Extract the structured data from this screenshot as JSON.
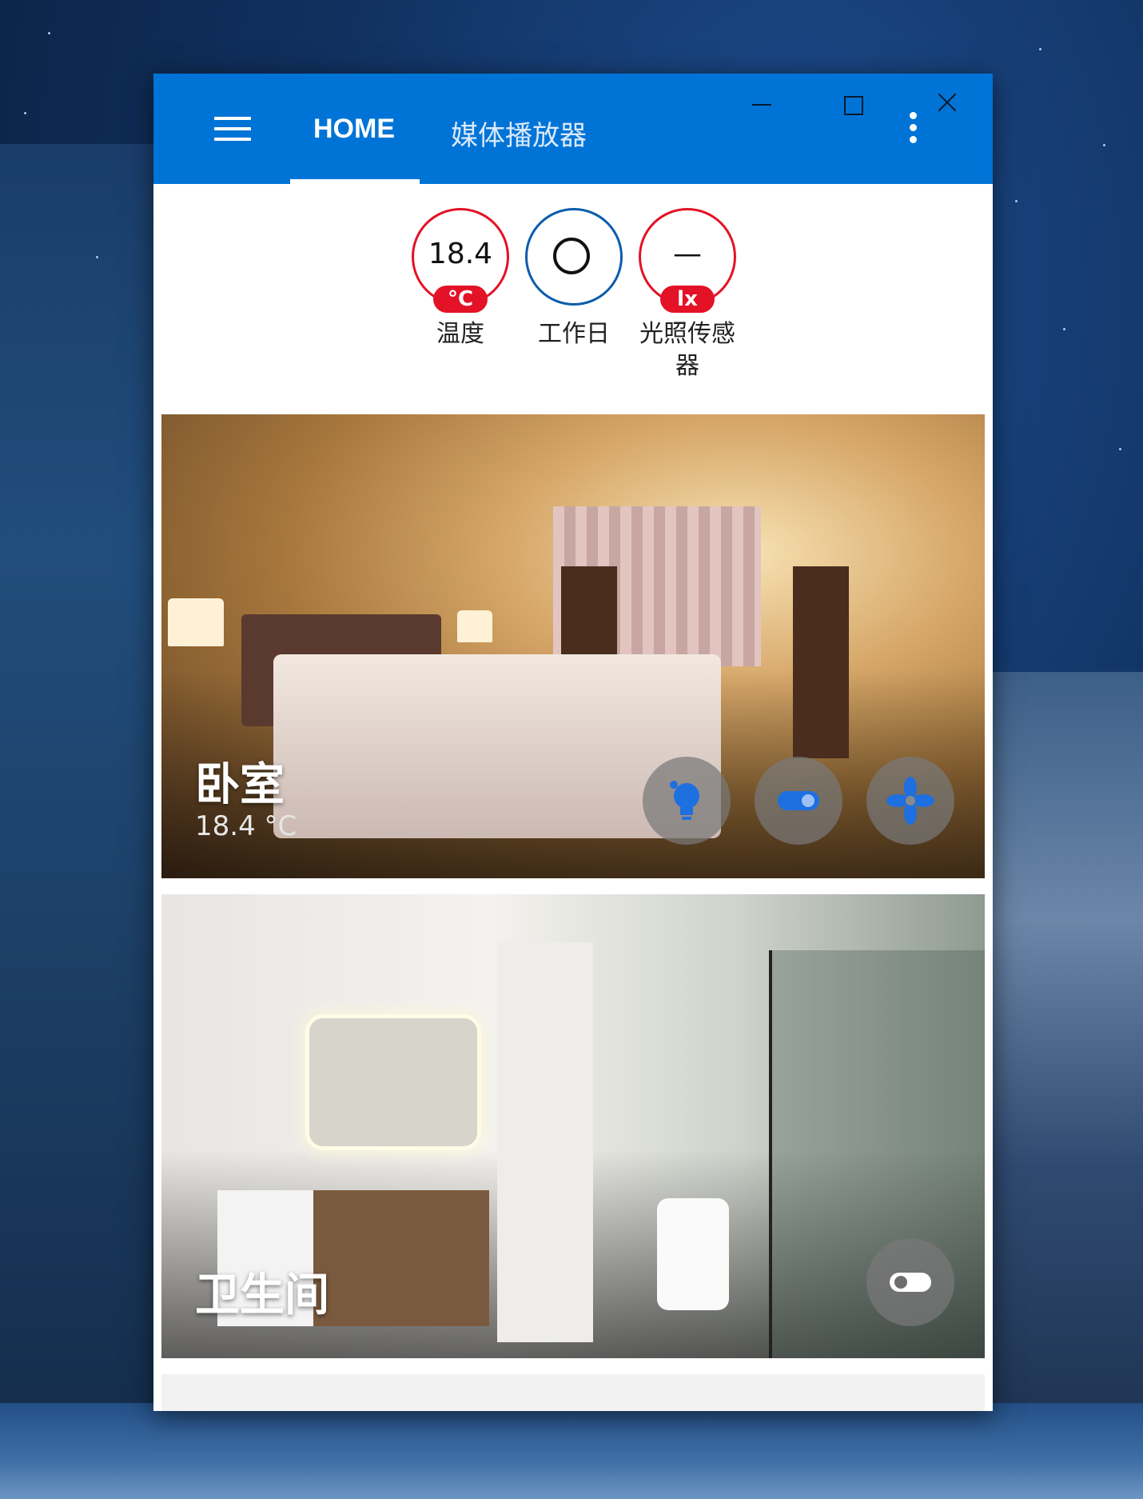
{
  "titlebar": {
    "tabs": [
      {
        "label": "HOME",
        "active": true
      },
      {
        "label": "媒体播放器",
        "active": false
      }
    ],
    "accent_color": "#0074d6",
    "icons": [
      "menu-icon",
      "minimize-icon",
      "maximize-icon",
      "close-icon",
      "more-vert-icon"
    ]
  },
  "badges": [
    {
      "value": "18.4",
      "unit": "°C",
      "label": "温度",
      "color": "#e31226"
    },
    {
      "value": "",
      "unit": "",
      "label": "工作日",
      "color": "#0b5cae",
      "icon": "ring-icon"
    },
    {
      "value": "—",
      "unit": "lx",
      "label": "光照传感器",
      "color": "#e31226"
    }
  ],
  "rooms": [
    {
      "name": "卧室",
      "temperature": "18.4 °C",
      "actions": [
        "lightbulb-icon",
        "toggle-icon",
        "fan-icon"
      ],
      "icon_color": "#1e6fe0"
    },
    {
      "name": "卫生间",
      "actions": [
        "toggle-icon"
      ],
      "icon_color": "#ffffff"
    }
  ]
}
